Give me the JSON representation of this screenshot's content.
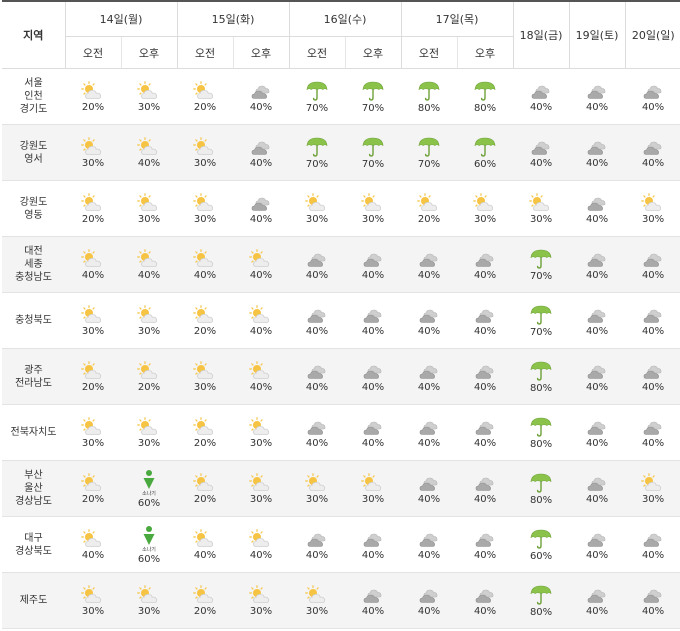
{
  "header": {
    "region_label": "지역",
    "am_label": "오전",
    "pm_label": "오후",
    "split_days": [
      "14일(월)",
      "15일(화)",
      "16일(수)",
      "17일(목)"
    ],
    "single_days": [
      "18일(금)",
      "19일(토)",
      "20일(일)"
    ]
  },
  "shower_text": "소나기",
  "rows": [
    {
      "region": [
        "서울",
        "인천",
        "경기도"
      ],
      "cells": [
        {
          "icon": "partly-cloudy",
          "pct": "20%"
        },
        {
          "icon": "partly-cloudy",
          "pct": "30%"
        },
        {
          "icon": "partly-cloudy",
          "pct": "20%"
        },
        {
          "icon": "cloudy",
          "pct": "40%"
        },
        {
          "icon": "rain",
          "pct": "70%"
        },
        {
          "icon": "rain",
          "pct": "70%"
        },
        {
          "icon": "rain",
          "pct": "80%"
        },
        {
          "icon": "rain",
          "pct": "80%"
        },
        {
          "icon": "cloudy",
          "pct": "40%"
        },
        {
          "icon": "cloudy",
          "pct": "40%"
        },
        {
          "icon": "cloudy",
          "pct": "40%"
        }
      ]
    },
    {
      "region": [
        "강원도",
        "영서"
      ],
      "cells": [
        {
          "icon": "partly-cloudy",
          "pct": "30%"
        },
        {
          "icon": "partly-cloudy",
          "pct": "40%"
        },
        {
          "icon": "partly-cloudy",
          "pct": "30%"
        },
        {
          "icon": "cloudy",
          "pct": "40%"
        },
        {
          "icon": "rain",
          "pct": "70%"
        },
        {
          "icon": "rain",
          "pct": "70%"
        },
        {
          "icon": "rain",
          "pct": "70%"
        },
        {
          "icon": "rain",
          "pct": "60%"
        },
        {
          "icon": "cloudy",
          "pct": "40%"
        },
        {
          "icon": "cloudy",
          "pct": "40%"
        },
        {
          "icon": "cloudy",
          "pct": "40%"
        }
      ]
    },
    {
      "region": [
        "강원도",
        "영동"
      ],
      "cells": [
        {
          "icon": "partly-cloudy",
          "pct": "20%"
        },
        {
          "icon": "partly-cloudy",
          "pct": "30%"
        },
        {
          "icon": "partly-cloudy",
          "pct": "30%"
        },
        {
          "icon": "cloudy",
          "pct": "40%"
        },
        {
          "icon": "partly-cloudy",
          "pct": "30%"
        },
        {
          "icon": "partly-cloudy",
          "pct": "30%"
        },
        {
          "icon": "partly-cloudy",
          "pct": "20%"
        },
        {
          "icon": "partly-cloudy",
          "pct": "30%"
        },
        {
          "icon": "partly-cloudy",
          "pct": "30%"
        },
        {
          "icon": "cloudy",
          "pct": "40%"
        },
        {
          "icon": "partly-cloudy",
          "pct": "30%"
        }
      ]
    },
    {
      "region": [
        "대전",
        "세종",
        "충청남도"
      ],
      "cells": [
        {
          "icon": "partly-cloudy",
          "pct": "40%"
        },
        {
          "icon": "partly-cloudy",
          "pct": "40%"
        },
        {
          "icon": "partly-cloudy",
          "pct": "40%"
        },
        {
          "icon": "partly-cloudy",
          "pct": "40%"
        },
        {
          "icon": "cloudy",
          "pct": "40%"
        },
        {
          "icon": "cloudy",
          "pct": "40%"
        },
        {
          "icon": "cloudy",
          "pct": "40%"
        },
        {
          "icon": "cloudy",
          "pct": "40%"
        },
        {
          "icon": "rain",
          "pct": "70%"
        },
        {
          "icon": "cloudy",
          "pct": "40%"
        },
        {
          "icon": "cloudy",
          "pct": "40%"
        }
      ]
    },
    {
      "region": [
        "충청북도"
      ],
      "cells": [
        {
          "icon": "partly-cloudy",
          "pct": "30%"
        },
        {
          "icon": "partly-cloudy",
          "pct": "30%"
        },
        {
          "icon": "partly-cloudy",
          "pct": "20%"
        },
        {
          "icon": "partly-cloudy",
          "pct": "40%"
        },
        {
          "icon": "cloudy",
          "pct": "40%"
        },
        {
          "icon": "cloudy",
          "pct": "40%"
        },
        {
          "icon": "cloudy",
          "pct": "40%"
        },
        {
          "icon": "cloudy",
          "pct": "40%"
        },
        {
          "icon": "rain",
          "pct": "70%"
        },
        {
          "icon": "cloudy",
          "pct": "40%"
        },
        {
          "icon": "cloudy",
          "pct": "40%"
        }
      ]
    },
    {
      "region": [
        "광주",
        "전라남도"
      ],
      "cells": [
        {
          "icon": "partly-cloudy",
          "pct": "20%"
        },
        {
          "icon": "partly-cloudy",
          "pct": "20%"
        },
        {
          "icon": "partly-cloudy",
          "pct": "30%"
        },
        {
          "icon": "partly-cloudy",
          "pct": "40%"
        },
        {
          "icon": "cloudy",
          "pct": "40%"
        },
        {
          "icon": "cloudy",
          "pct": "40%"
        },
        {
          "icon": "cloudy",
          "pct": "40%"
        },
        {
          "icon": "cloudy",
          "pct": "40%"
        },
        {
          "icon": "rain",
          "pct": "80%"
        },
        {
          "icon": "cloudy",
          "pct": "40%"
        },
        {
          "icon": "cloudy",
          "pct": "40%"
        }
      ]
    },
    {
      "region": [
        "전북자치도"
      ],
      "cells": [
        {
          "icon": "partly-cloudy",
          "pct": "30%"
        },
        {
          "icon": "partly-cloudy",
          "pct": "30%"
        },
        {
          "icon": "partly-cloudy",
          "pct": "20%"
        },
        {
          "icon": "partly-cloudy",
          "pct": "30%"
        },
        {
          "icon": "cloudy",
          "pct": "40%"
        },
        {
          "icon": "cloudy",
          "pct": "40%"
        },
        {
          "icon": "cloudy",
          "pct": "40%"
        },
        {
          "icon": "cloudy",
          "pct": "40%"
        },
        {
          "icon": "rain",
          "pct": "80%"
        },
        {
          "icon": "cloudy",
          "pct": "40%"
        },
        {
          "icon": "cloudy",
          "pct": "40%"
        }
      ]
    },
    {
      "region": [
        "부산",
        "울산",
        "경상남도"
      ],
      "cells": [
        {
          "icon": "partly-cloudy",
          "pct": "20%"
        },
        {
          "icon": "shower",
          "pct": "60%"
        },
        {
          "icon": "partly-cloudy",
          "pct": "20%"
        },
        {
          "icon": "partly-cloudy",
          "pct": "30%"
        },
        {
          "icon": "partly-cloudy",
          "pct": "30%"
        },
        {
          "icon": "partly-cloudy",
          "pct": "30%"
        },
        {
          "icon": "cloudy",
          "pct": "40%"
        },
        {
          "icon": "cloudy",
          "pct": "40%"
        },
        {
          "icon": "rain",
          "pct": "80%"
        },
        {
          "icon": "cloudy",
          "pct": "40%"
        },
        {
          "icon": "partly-cloudy",
          "pct": "30%"
        }
      ]
    },
    {
      "region": [
        "대구",
        "경상북도"
      ],
      "cells": [
        {
          "icon": "partly-cloudy",
          "pct": "40%"
        },
        {
          "icon": "shower",
          "pct": "60%"
        },
        {
          "icon": "partly-cloudy",
          "pct": "40%"
        },
        {
          "icon": "partly-cloudy",
          "pct": "40%"
        },
        {
          "icon": "cloudy",
          "pct": "40%"
        },
        {
          "icon": "cloudy",
          "pct": "40%"
        },
        {
          "icon": "cloudy",
          "pct": "40%"
        },
        {
          "icon": "cloudy",
          "pct": "40%"
        },
        {
          "icon": "rain",
          "pct": "60%"
        },
        {
          "icon": "cloudy",
          "pct": "40%"
        },
        {
          "icon": "cloudy",
          "pct": "40%"
        }
      ]
    },
    {
      "region": [
        "제주도"
      ],
      "cells": [
        {
          "icon": "partly-cloudy",
          "pct": "30%"
        },
        {
          "icon": "partly-cloudy",
          "pct": "30%"
        },
        {
          "icon": "partly-cloudy",
          "pct": "20%"
        },
        {
          "icon": "partly-cloudy",
          "pct": "30%"
        },
        {
          "icon": "partly-cloudy",
          "pct": "30%"
        },
        {
          "icon": "cloudy",
          "pct": "40%"
        },
        {
          "icon": "cloudy",
          "pct": "40%"
        },
        {
          "icon": "cloudy",
          "pct": "40%"
        },
        {
          "icon": "rain",
          "pct": "80%"
        },
        {
          "icon": "cloudy",
          "pct": "40%"
        },
        {
          "icon": "cloudy",
          "pct": "40%"
        }
      ]
    }
  ]
}
